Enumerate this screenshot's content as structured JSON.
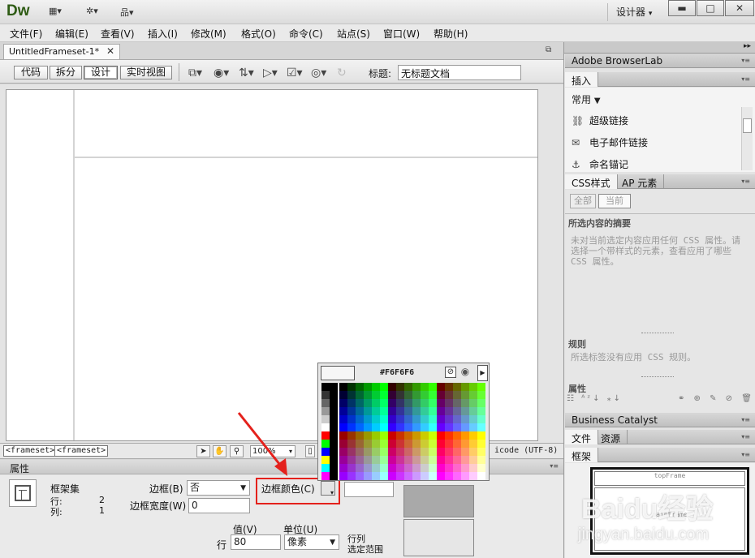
{
  "app": {
    "logo": "Dw",
    "workspace": "设计器",
    "window_buttons": [
      "▬",
      "□",
      "✕"
    ]
  },
  "menu": [
    "文件(F)",
    "编辑(E)",
    "查看(V)",
    "插入(I)",
    "修改(M)",
    "格式(O)",
    "命令(C)",
    "站点(S)",
    "窗口(W)",
    "帮助(H)"
  ],
  "document": {
    "tab_name": "UntitledFrameset-1*",
    "view_buttons": [
      "代码",
      "拆分",
      "设计",
      "实时视图"
    ],
    "active_view": "设计",
    "title_label": "标题:",
    "title_value": "无标题文档"
  },
  "status": {
    "tags": [
      "<frameset>",
      "<frameset>"
    ],
    "zoom": "100%",
    "encoding": "icode (UTF-8)"
  },
  "properties": {
    "header": "属性",
    "frameset_label": "框架集",
    "rows_label": "行:",
    "rows_value": "2",
    "cols_label": "列:",
    "cols_value": "1",
    "border_label": "边框(B)",
    "border_value": "否",
    "border_color_label": "边框颜色(C)",
    "border_width_label": "边框宽度(W)",
    "border_width_value": "0",
    "value_label": "值(V)",
    "unit_label": "单位(U)",
    "row_label": "行",
    "row_value": "80",
    "unit_value": "像素",
    "rowcol_label": "行列",
    "select_range_label": "选定范围"
  },
  "color_picker": {
    "current_hex": "#F6F6F6",
    "current_color": "#f6f6f6"
  },
  "panels": {
    "browserlab": "Adobe BrowserLab",
    "insert_tab": "插入",
    "insert_category": "常用",
    "insert_items": [
      "超级链接",
      "电子邮件链接",
      "命名锚记"
    ],
    "css_tabs": [
      "CSS样式",
      "AP 元素"
    ],
    "css_modes": [
      "全部",
      "当前"
    ],
    "css_summary_title": "所选内容的摘要",
    "css_summary_text": "未对当前选定内容应用任何 CSS 属性。请选择一个带样式的元素，查看应用了哪些 CSS 属性。",
    "rules_title": "规则",
    "rules_text": "所选标签没有应用 CSS 规则。",
    "props_title": "属性",
    "business_catalyst": "Business Catalyst",
    "files_tabs": [
      "文件",
      "资源"
    ],
    "frames_tab": "框架",
    "frames_top": "topFrame",
    "frames_main": "mainFrame"
  },
  "watermark": {
    "brand": "Baidu经验",
    "url": "jingyan.baidu.com"
  }
}
